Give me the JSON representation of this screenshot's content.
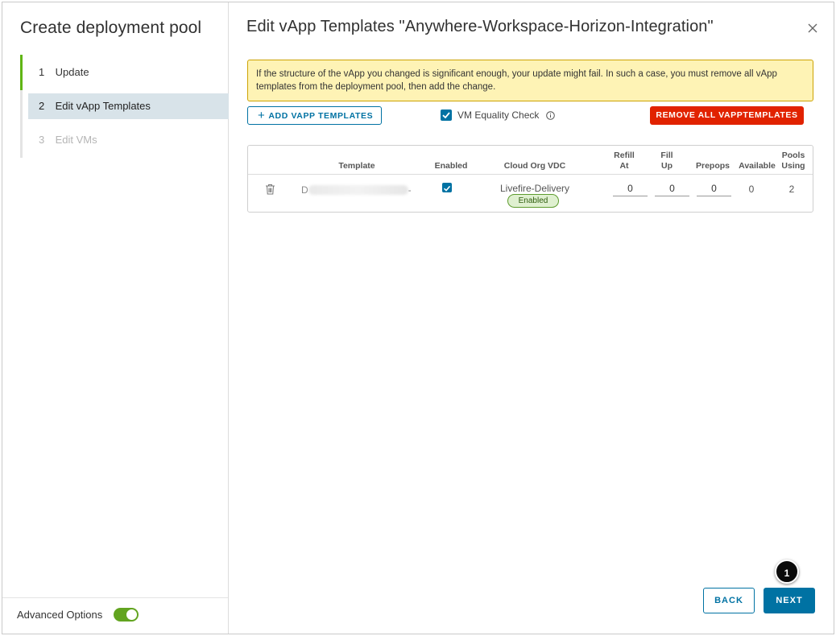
{
  "wizard": {
    "title": "Create deployment pool",
    "steps": [
      {
        "num": "1",
        "label": "Update"
      },
      {
        "num": "2",
        "label": "Edit vApp Templates"
      },
      {
        "num": "3",
        "label": "Edit VMs"
      }
    ],
    "advanced_options_label": "Advanced Options",
    "advanced_options_on": true
  },
  "main": {
    "title": "Edit vApp Templates \"Anywhere-Workspace-Horizon-Integration\"",
    "warning": "If the structure of the vApp you changed is significant enough, your update might fail. In such a case, you must remove all vApp templates from the deployment pool, then add the change.",
    "add_button": "ADD VAPP TEMPLATES",
    "vm_equality_check_label": "VM Equality Check",
    "vm_equality_check": true,
    "remove_all_button": "REMOVE ALL VAPPTEMPLATES",
    "table": {
      "headers": {
        "template": "Template",
        "enabled": "Enabled",
        "vdc": "Cloud Org VDC",
        "refill_1": "Refill",
        "refill_2": "At",
        "fill_1": "Fill",
        "fill_2": "Up",
        "prepops": "Prepops",
        "available": "Available",
        "pools_1": "Pools",
        "pools_2": "Using"
      },
      "rows": [
        {
          "template_prefix": "D",
          "template_suffix": "-",
          "enabled": true,
          "vdc": "Livefire-Delivery",
          "vdc_status": "Enabled",
          "refill_at": "0",
          "fill_up": "0",
          "prepops": "0",
          "available": "0",
          "pools_using": "2"
        }
      ]
    }
  },
  "footer": {
    "back_button": "BACK",
    "next_button": "NEXT",
    "callout": "1"
  },
  "colors": {
    "accent": "#0072a3",
    "danger": "#e12200",
    "success": "#62a420",
    "warning_bg": "#fef3b5"
  }
}
